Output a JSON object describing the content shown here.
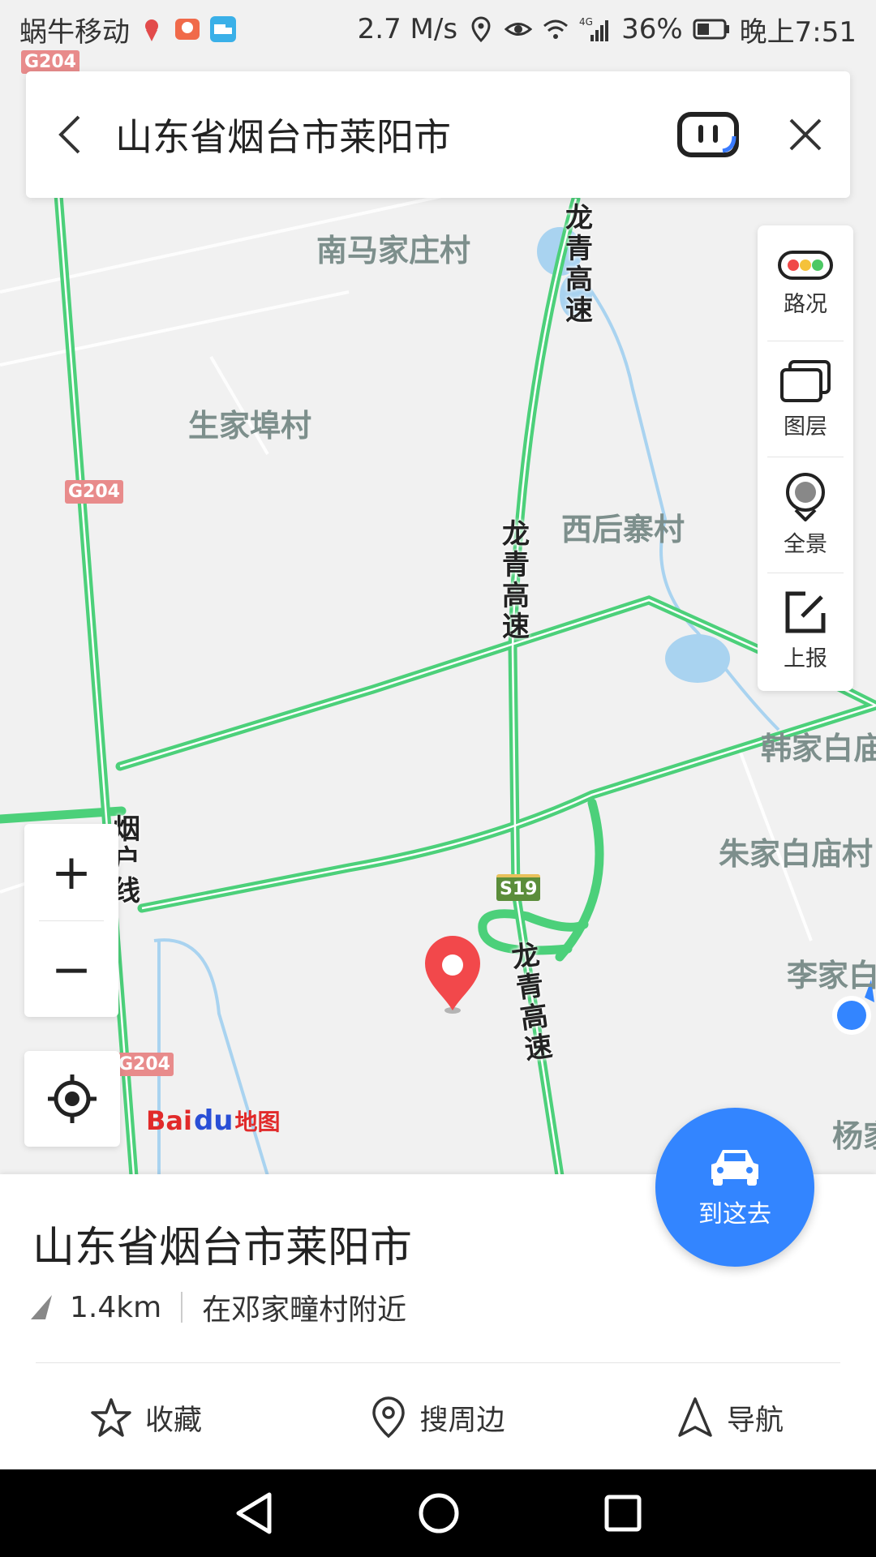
{
  "status_bar": {
    "carrier": "蜗牛移动",
    "speed": "2.7 M/s",
    "battery": "36%",
    "time": "晚上7:51",
    "network": "4G"
  },
  "search": {
    "query": "山东省烟台市莱阳市"
  },
  "map": {
    "places": [
      "南马家庄村",
      "生家埠村",
      "西后寨村",
      "韩家白庙",
      "朱家白庙村",
      "李家白",
      "杨家"
    ],
    "roads": [
      "龙青高速",
      "龙青高速",
      "龙青高速",
      "烟户线"
    ],
    "shields": [
      "G204",
      "G204",
      "G204",
      "S19"
    ],
    "route_color": "#4cd07a",
    "water_color": "#a9d3f0",
    "pin_color": "#f2484b",
    "location_color": "#3385ff"
  },
  "tools": [
    {
      "label": "路况",
      "icon": "traffic-light-icon"
    },
    {
      "label": "图层",
      "icon": "layers-icon"
    },
    {
      "label": "全景",
      "icon": "panorama-icon"
    },
    {
      "label": "上报",
      "icon": "report-icon"
    }
  ],
  "zoom": {
    "in": "+",
    "out": "−"
  },
  "logo": {
    "text1": "Bai",
    "text2": "du",
    "text3": "地图"
  },
  "result": {
    "title": "山东省烟台市莱阳市",
    "distance": "1.4km",
    "nearby": "在邓家疃村附近"
  },
  "go_button": {
    "label": "到这去"
  },
  "actions": [
    {
      "label": "收藏",
      "icon": "star-icon"
    },
    {
      "label": "搜周边",
      "icon": "location-pin-icon"
    },
    {
      "label": "导航",
      "icon": "navigation-arrow-icon"
    }
  ]
}
